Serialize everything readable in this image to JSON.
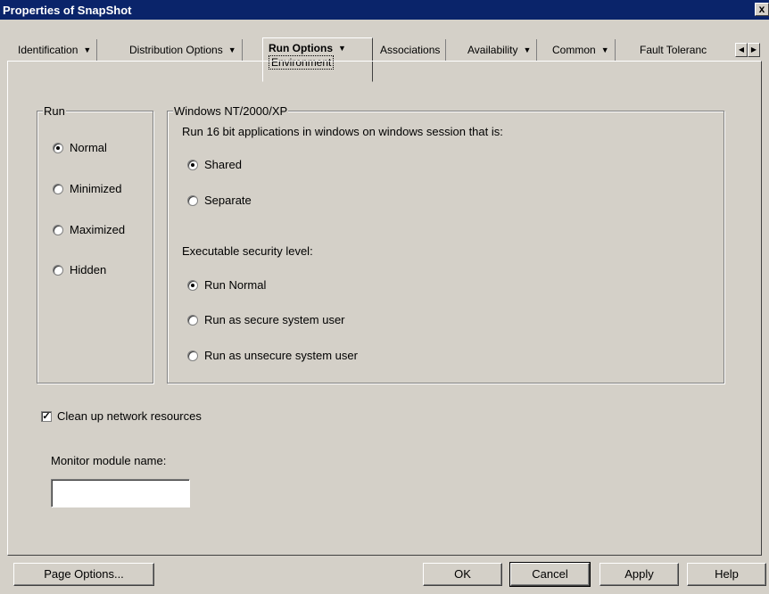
{
  "window": {
    "title": "Properties of SnapShot",
    "close_glyph": "x"
  },
  "tabs": [
    {
      "label": "Identification",
      "has_menu": true
    },
    {
      "label": "Distribution Options",
      "has_menu": true
    },
    {
      "label": "Run Options",
      "has_menu": true,
      "active": true,
      "subpage": "Environment"
    },
    {
      "label": "Associations",
      "has_menu": false
    },
    {
      "label": "Availability",
      "has_menu": true
    },
    {
      "label": "Common",
      "has_menu": true
    },
    {
      "label": "Fault Toleranc",
      "has_menu": false
    }
  ],
  "run_group": {
    "legend": "Run",
    "options": [
      {
        "label": "Normal",
        "selected": true
      },
      {
        "label": "Minimized",
        "selected": false
      },
      {
        "label": "Maximized",
        "selected": false
      },
      {
        "label": "Hidden",
        "selected": false
      }
    ]
  },
  "windows_group": {
    "legend": "Windows NT/2000/XP",
    "session_prompt": "Run 16 bit applications in windows on windows session that is:",
    "session_options": [
      {
        "label": "Shared",
        "selected": true
      },
      {
        "label": "Separate",
        "selected": false
      }
    ],
    "security_prompt": "Executable security level:",
    "security_options": [
      {
        "label": "Run Normal",
        "selected": true
      },
      {
        "label": "Run as secure system user",
        "selected": false
      },
      {
        "label": "Run as unsecure system user",
        "selected": false
      }
    ]
  },
  "cleanup": {
    "label": "Clean up network resources",
    "checked": true
  },
  "monitor": {
    "label": "Monitor module name:",
    "value": ""
  },
  "buttons": {
    "page_options": "Page Options...",
    "ok": "OK",
    "cancel": "Cancel",
    "apply": "Apply",
    "help": "Help"
  }
}
